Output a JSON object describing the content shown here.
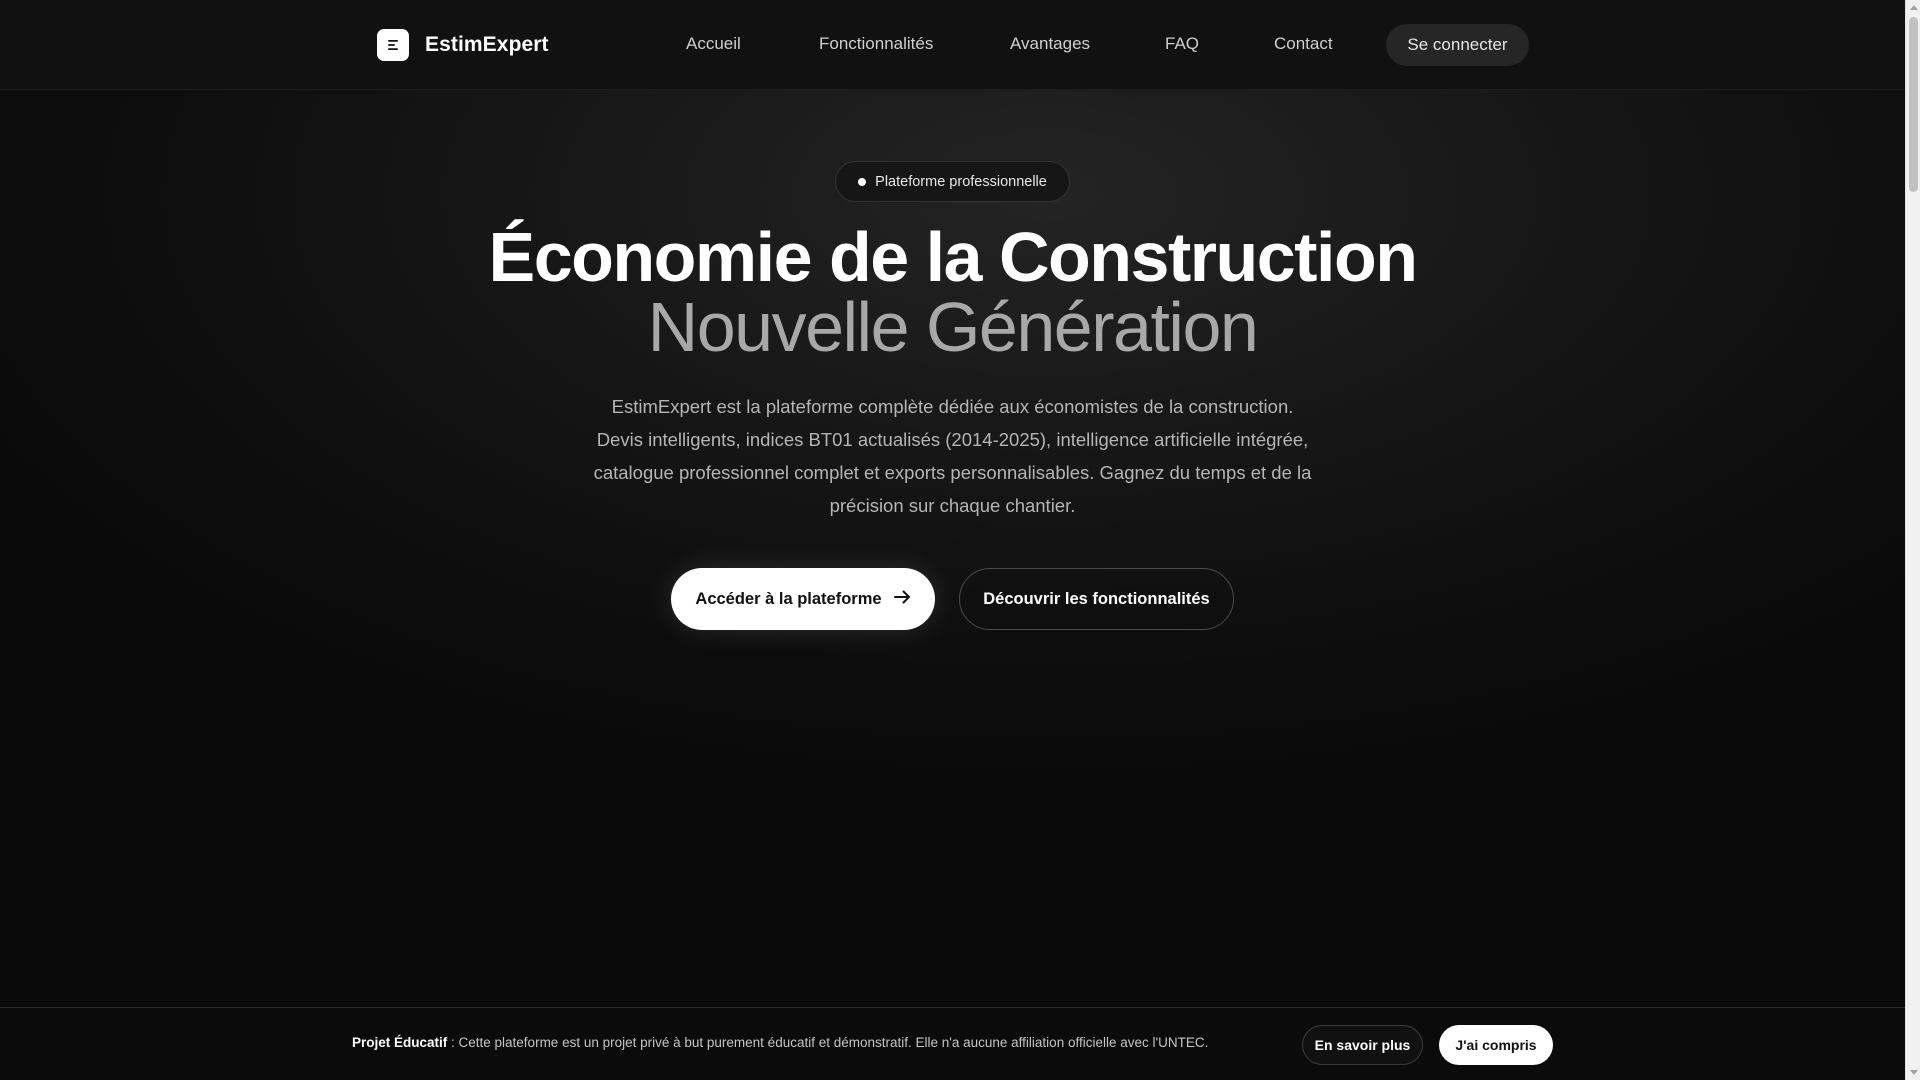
{
  "header": {
    "brand_name": "EstimExpert",
    "logo_icon": "menu-lines-icon",
    "nav": [
      {
        "label": "Accueil"
      },
      {
        "label": "Fonctionnalités"
      },
      {
        "label": "Avantages"
      },
      {
        "label": "FAQ"
      },
      {
        "label": "Contact"
      }
    ],
    "login_label": "Se connecter"
  },
  "hero": {
    "badge": "Plateforme professionnelle",
    "title_strong": "Économie de la Construction",
    "title_light": "Nouvelle Génération",
    "description": "EstimExpert est la plateforme complète dédiée aux économistes de la construction. Devis intelligents, indices BT01 actualisés (2014-2025), intelligence artificielle intégrée, catalogue professionnel complet et exports personnalisables. Gagnez du temps et de la précision sur chaque chantier.",
    "primary_cta": "Accéder à la plateforme",
    "primary_cta_icon": "arrow-right-icon",
    "secondary_cta": "Découvrir les fonctionnalités"
  },
  "banner": {
    "label": "Projet Éducatif",
    "text": " : Cette plateforme est un projet privé à but purement éducatif et démonstratif. Elle n'a aucune affiliation officielle avec l'UNTEC.",
    "learn_more": "En savoir plus",
    "accept": "J'ai compris"
  },
  "colors": {
    "background": "#0b0b0b",
    "header": "#111111",
    "accent": "#ffffff",
    "muted_text": "#b5b5b5"
  }
}
